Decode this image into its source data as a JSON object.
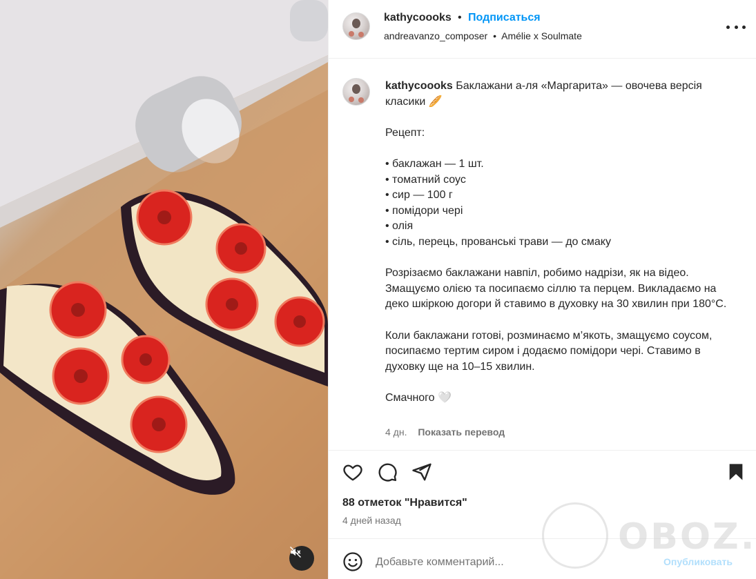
{
  "header": {
    "username": "kathycoooks",
    "separator": "•",
    "follow_label": "Подписаться",
    "audio_artist": "andreavanzo_composer",
    "audio_separator": "•",
    "audio_track": "Amélie x Soulmate"
  },
  "caption": {
    "username": "kathycoooks",
    "title": "Баклажани а-ля «Маргарита» — овочева версія класики 🥖",
    "recipe_heading": "Рецепт:",
    "ingredients": [
      "• баклажан — 1 шт.",
      "• томатний соус",
      "• сир — 100 г",
      "• помідори чері",
      "• олія",
      "• сіль, перець, прованські трави — до смаку"
    ],
    "step1": "Розрізаємо баклажани навпіл, робимо надрізи, як на відео. Змащуємо олією та посипаємо сіллю та перцем. Викладаємо на деко шкіркою догори й ставимо в духовку на 30 хвилин при 180°C.",
    "step2": "Коли баклажани готові, розминаємо м’якоть, змащуємо соусом, посипаємо тертим сиром і додаємо помідори чері. Ставимо в духовку ще на 10–15 хвилин.",
    "closing": "Смачного 🤍",
    "age": "4 дн.",
    "translate_label": "Показать перевод"
  },
  "engagement": {
    "likes": "88 отметок \"Нравится\"",
    "posted": "4 дней назад"
  },
  "comment": {
    "placeholder": "Добавьте комментарий...",
    "publish_label": "Опубликовать"
  },
  "watermark": {
    "text": "OBOZ.UA"
  },
  "colors": {
    "link": "#0095f6",
    "publish_disabled": "#b2dffc",
    "muted_text": "#737373"
  }
}
